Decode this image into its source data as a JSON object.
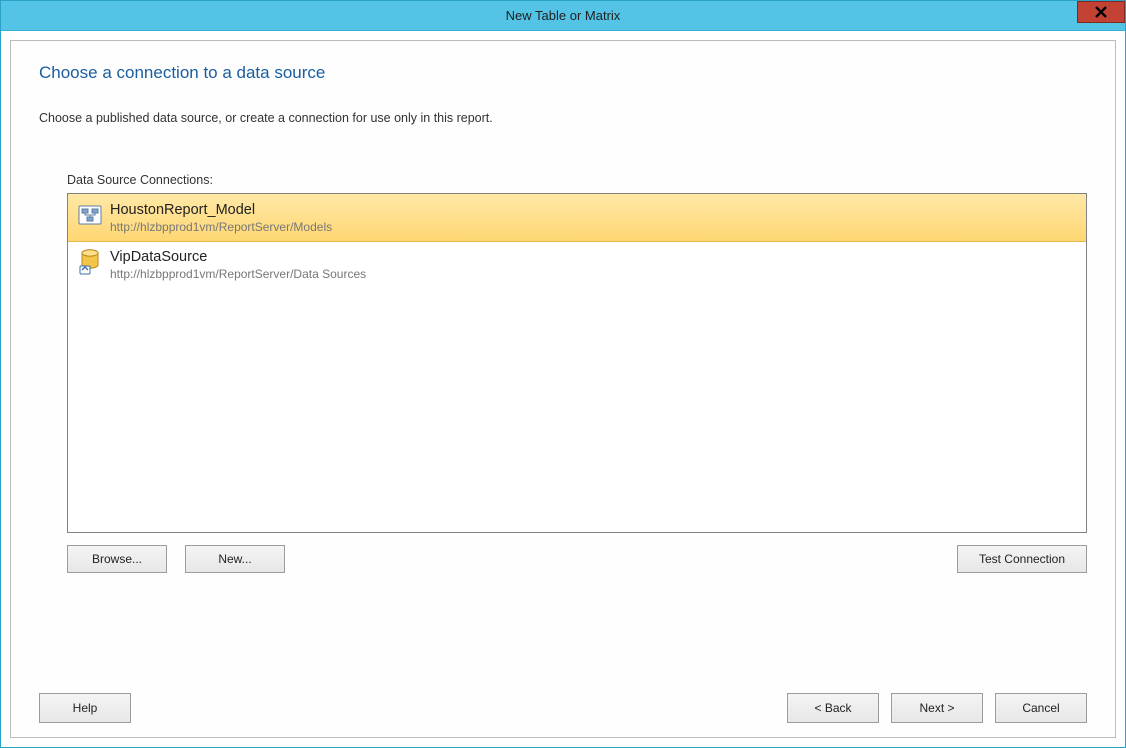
{
  "window": {
    "title": "New Table or Matrix"
  },
  "page": {
    "heading": "Choose a connection to a data source",
    "subheading": "Choose a published data source, or create a connection for use only in this report.",
    "list_label": "Data Source Connections:"
  },
  "data_sources": [
    {
      "name": "HoustonReport_Model",
      "path": "http://hlzbpprod1vm/ReportServer/Models",
      "icon": "model",
      "selected": true
    },
    {
      "name": "VipDataSource",
      "path": "http://hlzbpprod1vm/ReportServer/Data Sources",
      "icon": "db",
      "selected": false
    }
  ],
  "buttons": {
    "browse": "Browse...",
    "new": "New...",
    "test": "Test Connection",
    "help": "Help",
    "back": "< Back",
    "next": "Next >",
    "cancel": "Cancel"
  }
}
